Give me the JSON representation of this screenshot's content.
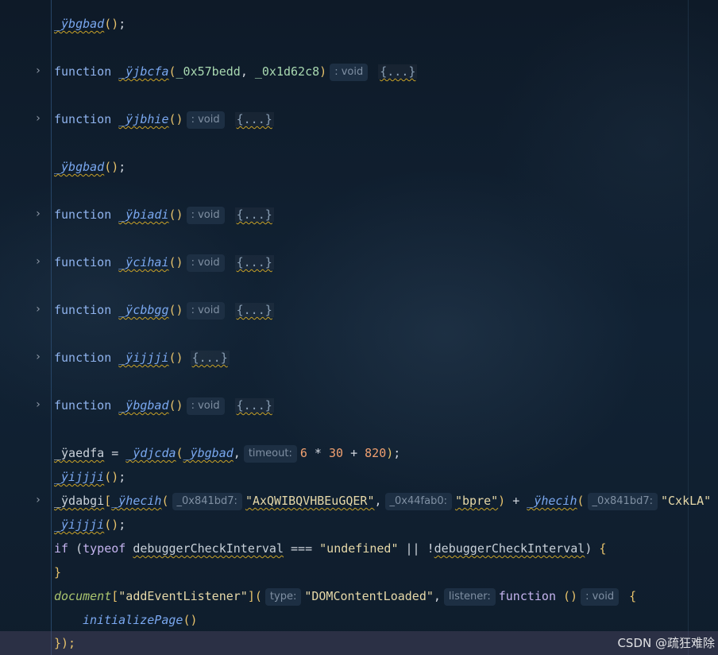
{
  "lines": [
    {
      "prefix": "",
      "name": "_ÿbgbad",
      "suffix": "();"
    },
    {
      "kw": "function",
      "name": "_ÿjbcfa",
      "p1": "_0x57bedd",
      "p2": "_0x1d62c8",
      "hint": ": void",
      "block": "{...}"
    },
    {
      "kw": "function",
      "name": "_ÿjbhie",
      "hint": ": void",
      "block": "{...}"
    },
    {
      "prefix": "",
      "name": "_ÿbgbad",
      "suffix": "();"
    },
    {
      "kw": "function",
      "name": "_ÿbiadi",
      "hint": ": void",
      "block": "{...}"
    },
    {
      "kw": "function",
      "name": "_ÿcihai",
      "hint": ": void",
      "block": "{...}"
    },
    {
      "kw": "function",
      "name": "_ÿcbbgg",
      "hint": ": void",
      "block": "{...}"
    },
    {
      "kw": "function",
      "name": "_ÿijjji",
      "block": "{...}"
    },
    {
      "kw": "function",
      "name": "_ÿbgbad",
      "hint": ": void",
      "block": "{...}"
    },
    {
      "var": "_ÿaedfa",
      "fn": "_ÿdjcda",
      "arg": "_ÿbgbad",
      "hint": "timeout:",
      "n1": "6",
      "n2": "30",
      "n3": "820"
    },
    {
      "name": "_ÿijjji",
      "suffix": "();"
    },
    {
      "obj": "_ÿdabgi",
      "fn": "_ÿhecih",
      "h1": "_0x841bd7:",
      "s1": "\"AxQWIBQVHBEuGQER\"",
      "h2": "_0x44fab0:",
      "s2": "\"bpre\"",
      "fn2": "_ÿhecih",
      "h3": "_0x841bd7:",
      "s3": "\"CxkLA\""
    },
    {
      "name": "_ÿijjji",
      "suffix": "();"
    },
    {
      "if": "if",
      "typeof": "typeof",
      "id": "debuggerCheckInterval",
      "eq": "===",
      "str": "\"undefined\"",
      "or": "||",
      "not": "!",
      "id2": "debuggerCheckInterval"
    },
    {
      "close": "}"
    },
    {
      "doc": "document",
      "key": "\"addEventListener\"",
      "h1": "type:",
      "s1": "\"DOMContentLoaded\"",
      "h2": "listener:",
      "kw": "function",
      "hint": ": void"
    },
    {
      "call": "initializePage",
      "suffix": "()"
    },
    {
      "close": "});"
    }
  ],
  "watermark": "CSDN @疏狂难除",
  "icons": {
    "fold": "chevron-right-icon"
  }
}
